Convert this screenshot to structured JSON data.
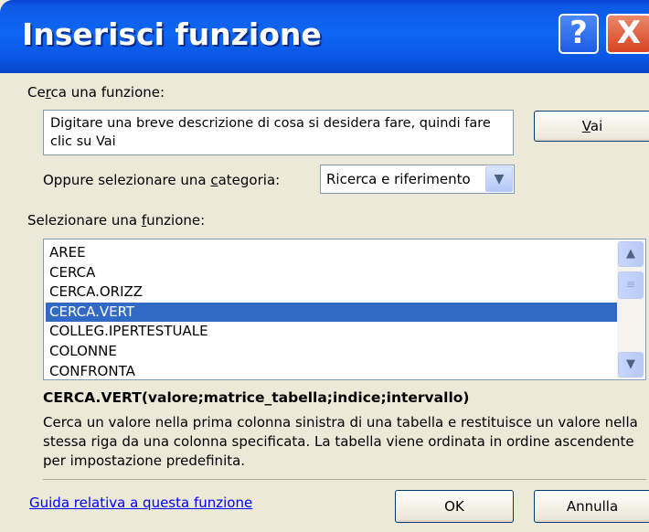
{
  "window": {
    "title": "Inserisci funzione",
    "help_glyph": "?",
    "close_glyph": "X"
  },
  "search": {
    "label_pre": "Ce",
    "label_accel": "r",
    "label_post": "ca una funzione:",
    "text": "Digitare una breve descrizione di cosa si desidera fare, quindi fare clic su Vai",
    "go_button_accel": "V",
    "go_button_rest": "ai"
  },
  "category": {
    "label_pre": "Oppure selezionare una ",
    "label_accel": "c",
    "label_post": "ategoria:",
    "selected": "Ricerca e riferimento",
    "arrow_icon": "chevron-down-icon"
  },
  "functions": {
    "label_pre": "Selezionare una ",
    "label_accel": "f",
    "label_post": "unzione:",
    "items": [
      "AREE",
      "CERCA",
      "CERCA.ORIZZ",
      "CERCA.VERT",
      "COLLEG.IPERTESTUALE",
      "COLONNE",
      "CONFRONTA"
    ],
    "selected_index": 3
  },
  "details": {
    "signature": "CERCA.VERT(valore;matrice_tabella;indice;intervallo)",
    "description": "Cerca un valore nella prima colonna sinistra di una tabella e restituisce un valore nella stessa riga da una colonna specificata. La tabella viene ordinata in ordine ascendente per impostazione predefinita."
  },
  "footer": {
    "help_link": "Guida relativa a questa funzione",
    "ok_label": "OK",
    "cancel_label": "Annulla"
  },
  "colors": {
    "titlebar": "#0f67f3",
    "dialog_bg": "#ece9d8",
    "selection": "#316ac5",
    "link": "#0000ff"
  }
}
